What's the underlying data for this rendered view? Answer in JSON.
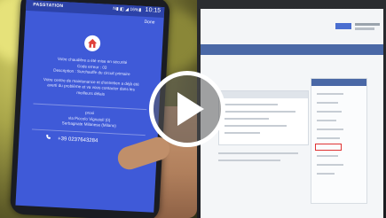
{
  "phone": {
    "app_name": "PASSTATION",
    "status_icons": "N▮ ◧ ◢ 16%▮",
    "time": "10:15",
    "action": "Done",
    "message_lines": [
      "Votre chaudière a été mise en sécurité",
      "Code erreur : 03",
      "Description : Surchauffe du circuit primaire",
      "",
      "Votre centre de maintenance et d'entretien a déjà été",
      "averti du problème et va vous contacter dans les",
      "meilleurs délais"
    ],
    "contact_lines": [
      "proxi",
      "via Piccolo Vignaioli (0)",
      "Serbagnate Milanese (Milano)"
    ],
    "phone_number": "+39 0237643284"
  },
  "player": {
    "play_icon": "play-icon"
  },
  "colors": {
    "phone_screen": "#3f5ad8",
    "status_bar": "#2c42a8",
    "play_ring": "#ffffff"
  }
}
